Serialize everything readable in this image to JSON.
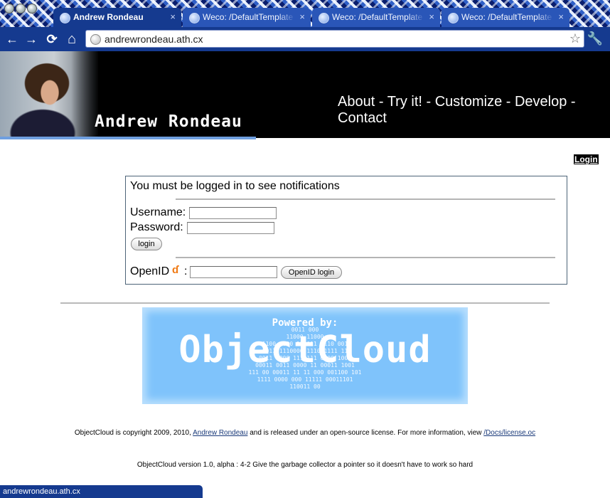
{
  "browser": {
    "tabs": [
      {
        "title": "Andrew Rondeau",
        "active": true
      },
      {
        "title": "Weco: /DefaultTemplate",
        "active": false
      },
      {
        "title": "Weco: /DefaultTemplate",
        "active": false
      },
      {
        "title": "Weco: /DefaultTemplate",
        "active": false
      }
    ],
    "tab_close_glyph": "×",
    "nav": {
      "back": "←",
      "forward": "→",
      "reload": "⟳",
      "home": "⌂",
      "star": "☆",
      "wrench": "🔧"
    },
    "url": "andrewrondeau.ath.cx",
    "status": "andrewrondeau.ath.cx"
  },
  "header": {
    "site_name": "Andrew Rondeau",
    "nav": [
      {
        "label": "About"
      },
      {
        "label": "Try it!"
      },
      {
        "label": "Customize"
      },
      {
        "label": "Develop"
      },
      {
        "label": "Contact"
      }
    ],
    "separator": " - "
  },
  "login_link": "Login",
  "notice": {
    "title": "You must be logged in to see notifications",
    "username_label": "Username:",
    "password_label": "Password:",
    "login_button": "login",
    "openid_label": "OpenID",
    "openid_colon": ":",
    "openid_button": "OpenID login"
  },
  "powered": {
    "caption": "Powered by:",
    "brand": "ObjectCloud",
    "binary": "0011 000\n11000 11000\n1100 0000 111011 1110 001\n0011 1110000 1110 1111 11\n0011 0000 1110111 0000 1001\n00011 0011 0000 11 00011 1001\n111 00 00011 11 11 000 001100 101\n1111 0000 000 11111 00011101\n110011 00"
  },
  "footer": {
    "line1_pre": "ObjectCloud is copyright 2009, 2010,",
    "line1_link": "Andrew Rondeau",
    "line1_mid": "and is released under an open-source license. For more information, view",
    "line1_link2": "/Docs/license.oc",
    "line2": "ObjectCloud version 1.0, alpha : 4-2 Give the garbage collector a pointer so it doesn't have to work so hard"
  },
  "colors": {
    "chrome_blue": "#153a8f",
    "banner_black": "#000000",
    "objectcloud_blue": "#7fc3fb",
    "openid_orange": "#f07a14"
  }
}
